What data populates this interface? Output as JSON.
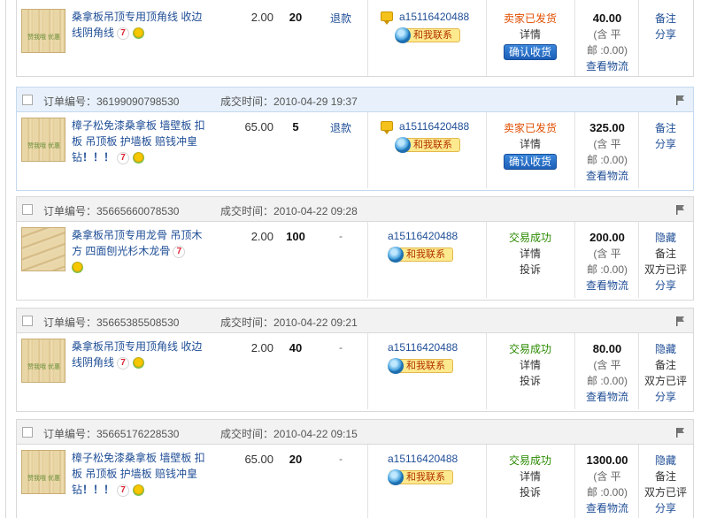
{
  "partial_top": {
    "title_lines": [
      "桑拿板吊顶专用顶角线 收边",
      "线阴角线"
    ],
    "price": "2.00",
    "qty": "20",
    "refund": "退款",
    "seller": "a15116420488",
    "contact": "和我联系",
    "status": "卖家已发货",
    "detail": "详情",
    "confirm": "确认收货",
    "total": "40.00",
    "shipping_1": "(含 平",
    "shipping_2": "邮 :0.00)",
    "logistics": "查看物流",
    "note": "备注",
    "share": "分享"
  },
  "orders": [
    {
      "orderno": "订单编号：36199090798530",
      "time": "成交时间：2010-04-29 19:37",
      "title_lines": [
        "樟子松免漆桑拿板 墙壁板 扣",
        "板 吊顶板 护墙板 赔钱冲皇",
        "钻"
      ],
      "title_excl": "！！！",
      "price": "65.00",
      "qty": "5",
      "refund": "退款",
      "seller": "a15116420488",
      "contact": "和我联系",
      "status": "卖家已发货",
      "detail": "详情",
      "confirm": "确认收货",
      "total": "325.00",
      "shipping_1": "(含 平",
      "shipping_2": "邮 :0.00)",
      "logistics": "查看物流",
      "note": "备注",
      "share": "分享"
    },
    {
      "orderno": "订单编号：35665660078530",
      "time": "成交时间：2010-04-22 09:28",
      "title_lines": [
        "桑拿板吊顶专用龙骨 吊顶木",
        "方 四面刨光杉木龙骨"
      ],
      "price": "2.00",
      "qty": "100",
      "refund": "-",
      "seller": "a15116420488",
      "contact": "和我联系",
      "status": "交易成功",
      "detail": "详情",
      "complain": "投诉",
      "total": "200.00",
      "shipping_1": "(含 平",
      "shipping_2": "邮 :0.00)",
      "logistics": "查看物流",
      "hide": "隐藏",
      "note": "备注",
      "rated": "双方已评",
      "share": "分享"
    },
    {
      "orderno": "订单编号：35665385508530",
      "time": "成交时间：2010-04-22 09:21",
      "title_lines": [
        "桑拿板吊顶专用顶角线 收边",
        "线阴角线"
      ],
      "price": "2.00",
      "qty": "40",
      "refund": "-",
      "seller": "a15116420488",
      "contact": "和我联系",
      "status": "交易成功",
      "detail": "详情",
      "complain": "投诉",
      "total": "80.00",
      "shipping_1": "(含 平",
      "shipping_2": "邮 :0.00)",
      "logistics": "查看物流",
      "hide": "隐藏",
      "note": "备注",
      "rated": "双方已评",
      "share": "分享"
    },
    {
      "orderno": "订单编号：35665176228530",
      "time": "成交时间：2010-04-22 09:15",
      "title_lines": [
        "樟子松免漆桑拿板 墙壁板 扣",
        "板 吊顶板 护墙板 赔钱冲皇",
        "钻"
      ],
      "title_excl": "！！！",
      "price": "65.00",
      "qty": "20",
      "refund": "-",
      "seller": "a15116420488",
      "contact": "和我联系",
      "status": "交易成功",
      "detail": "详情",
      "complain": "投诉",
      "total": "1300.00",
      "shipping_1": "(含 平",
      "shipping_2": "邮 :0.00)",
      "logistics": "查看物流",
      "hide": "隐藏",
      "note": "备注",
      "rated": "双方已评",
      "share": "分享"
    }
  ],
  "icons": {
    "badge7": "7",
    "flag": "flag-icon",
    "message": "message-icon",
    "contact_bubble": "wangwang-icon"
  },
  "colors": {
    "link": "#1f4e96",
    "shipped": "#e04e00",
    "success": "#2a8a00",
    "header_active": "#e8f1fb",
    "header": "#f2f2f2"
  }
}
